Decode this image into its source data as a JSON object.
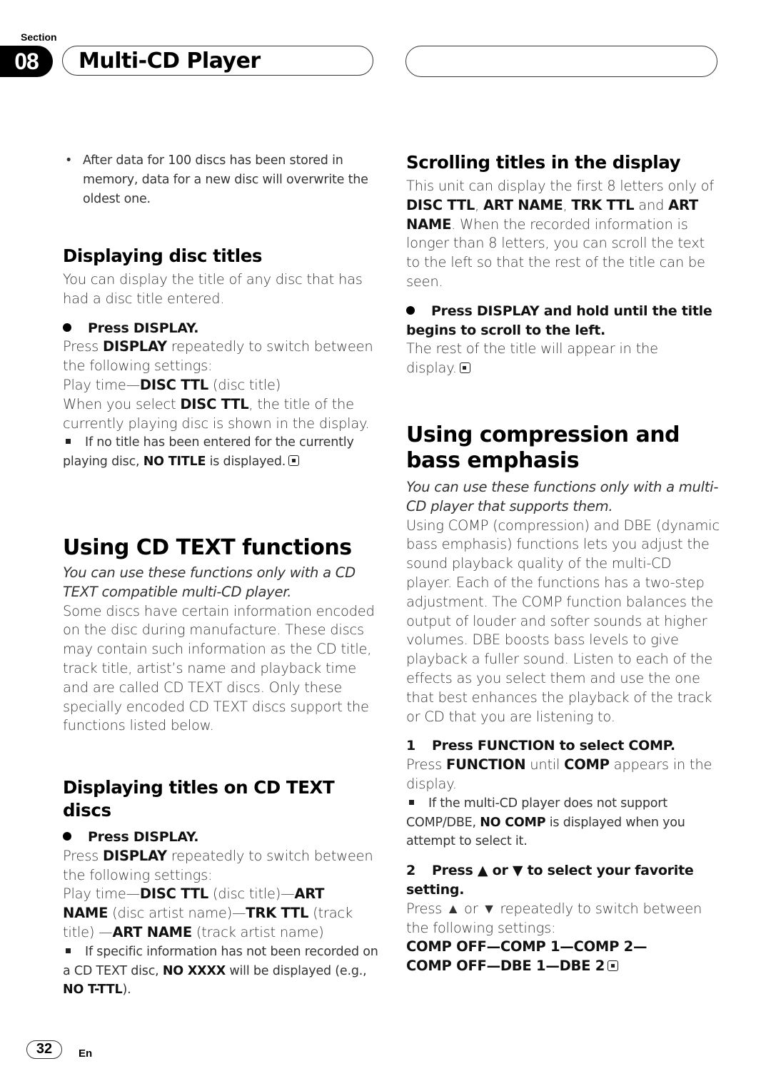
{
  "header": {
    "section_label": "Section",
    "section_number": "08",
    "chapter_title": "Multi-CD Player"
  },
  "left": {
    "intro_bullet": "After data for 100 discs has been stored in memory, data for a new disc will overwrite the oldest one.",
    "disc_titles": {
      "heading": "Displaying disc titles",
      "intro": "You can display the title of any disc that has had a disc title entered.",
      "step": "Press DISPLAY.",
      "p1_pre": "Press ",
      "p1_bold": "DISPLAY",
      "p1_post": " repeatedly to switch between the following settings:",
      "seq_pre": "Play time—",
      "seq_bold": "DISC TTL",
      "seq_post": " (disc title)",
      "p2_pre": "When you select ",
      "p2_bold": "DISC TTL",
      "p2_post": ", the title of the currently playing disc is shown in the display.",
      "note_pre": "If no title has been entered for the currently playing disc, ",
      "note_bold": "NO TITLE",
      "note_post": " is displayed."
    },
    "cd_text": {
      "heading": "Using CD TEXT functions",
      "italic": "You can use these functions only with a CD TEXT compatible multi-CD player.",
      "body": "Some discs have certain information encoded on the disc during manufacture. These discs may contain such information as the CD title, track title, artist’s name and playback time and are called CD TEXT discs. Only these specially encoded CD TEXT discs support the functions listed below."
    },
    "cd_text_titles": {
      "heading": "Displaying titles on CD TEXT discs",
      "step": "Press DISPLAY.",
      "p1_pre": "Press ",
      "p1_bold": "DISPLAY",
      "p1_post": " repeatedly to switch between the following settings:",
      "seq": [
        {
          "text": "Play time—",
          "bold": false
        },
        {
          "text": "DISC TTL",
          "bold": true
        },
        {
          "text": " (disc title)—",
          "bold": false
        },
        {
          "text": "ART NAME",
          "bold": true
        },
        {
          "text": " (disc artist name)—",
          "bold": false
        },
        {
          "text": "TRK TTL",
          "bold": true
        },
        {
          "text": " (track title) —",
          "bold": false
        },
        {
          "text": "ART NAME",
          "bold": true
        },
        {
          "text": " (track artist name)",
          "bold": false
        }
      ],
      "note_pre": "If specific information has not been recorded on a CD TEXT disc, ",
      "note_bold": "NO XXXX",
      "note_mid": " will be displayed (e.g., ",
      "note_bold2": "NO T-TTL",
      "note_post": ")."
    }
  },
  "right": {
    "scrolling": {
      "heading": "Scrolling titles in the display",
      "p_pre": "This unit can display the first 8 letters only of ",
      "b1": "DISC TTL",
      "sep1": ", ",
      "b2": "ART NAME",
      "sep2": ", ",
      "b3": "TRK TTL",
      "and": " and ",
      "b4": "ART NAME",
      "p_post": ". When the recorded information is longer than 8 letters, you can scroll the text to the left so that the rest of the title can be seen.",
      "step": "Press DISPLAY and hold until the title begins to scroll to the left.",
      "result": "The rest of the title will appear in the display."
    },
    "compression": {
      "heading": "Using compression and bass emphasis",
      "italic": "You can use these functions only with a multi-CD player that supports them.",
      "body": "Using COMP (compression) and DBE (dynamic bass emphasis) functions lets you adjust the sound playback quality of the multi-CD player. Each of the functions has a two-step adjustment. The COMP function balances the output of louder and softer sounds at higher volumes. DBE boosts bass levels to give playback a fuller sound. Listen to each of the effects as you select them and use the one that best enhances the playback of the track or CD that you are listening to.",
      "step1_num": "1",
      "step1": "Press FUNCTION to select COMP.",
      "s1_pre": "Press ",
      "s1_b1": "FUNCTION",
      "s1_mid": " until ",
      "s1_b2": "COMP",
      "s1_post": " appears in the display.",
      "s1_note_pre": "If the multi-CD player does not support COMP/DBE, ",
      "s1_note_bold": "NO COMP",
      "s1_note_post": " is displayed when you attempt to select it.",
      "step2_num": "2",
      "step2": "Press ▲ or ▼ to select your favorite setting.",
      "s2_text": "Press ▲ or ▼ repeatedly to switch between the following settings:",
      "seq_line1": "COMP OFF—COMP 1—COMP 2—",
      "seq_line2": "COMP OFF—DBE 1—DBE 2"
    }
  },
  "footer": {
    "page_number": "32",
    "language": "En"
  }
}
